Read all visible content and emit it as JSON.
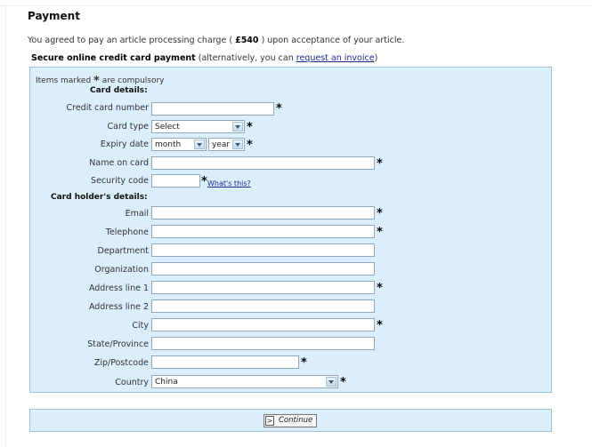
{
  "title": "Payment",
  "agreement": {
    "prefix": "You agreed to pay an article processing charge (",
    "amount": "£540",
    "suffix": ") upon acceptance of your article."
  },
  "secure": {
    "heading": "Secure online credit card payment",
    "middle": "(alternatively, you can",
    "link": "request an invoice",
    "end": ")"
  },
  "required_note": {
    "prefix": "Items marked",
    "star": "*",
    "suffix": "are compulsory"
  },
  "sections": {
    "card_details": "Card details:",
    "holder_details": "Card holder's details:"
  },
  "fields": {
    "card_number": "Credit card number",
    "card_type": "Card type",
    "expiry_date": "Expiry date",
    "name_on_card": "Name on card",
    "security_code": "Security code",
    "email": "Email",
    "telephone": "Telephone",
    "department": "Department",
    "organization": "Organization",
    "address1": "Address line 1",
    "address2": "Address line 2",
    "city": "City",
    "state": "State/Province",
    "zip": "Zip/Postcode",
    "country": "Country"
  },
  "selects": {
    "card_type": "Select",
    "expiry_month": "month",
    "expiry_year": "year",
    "country": "China"
  },
  "whats_this": "What's this?",
  "continue_button": {
    "glyph": ">",
    "label": "Continue"
  }
}
